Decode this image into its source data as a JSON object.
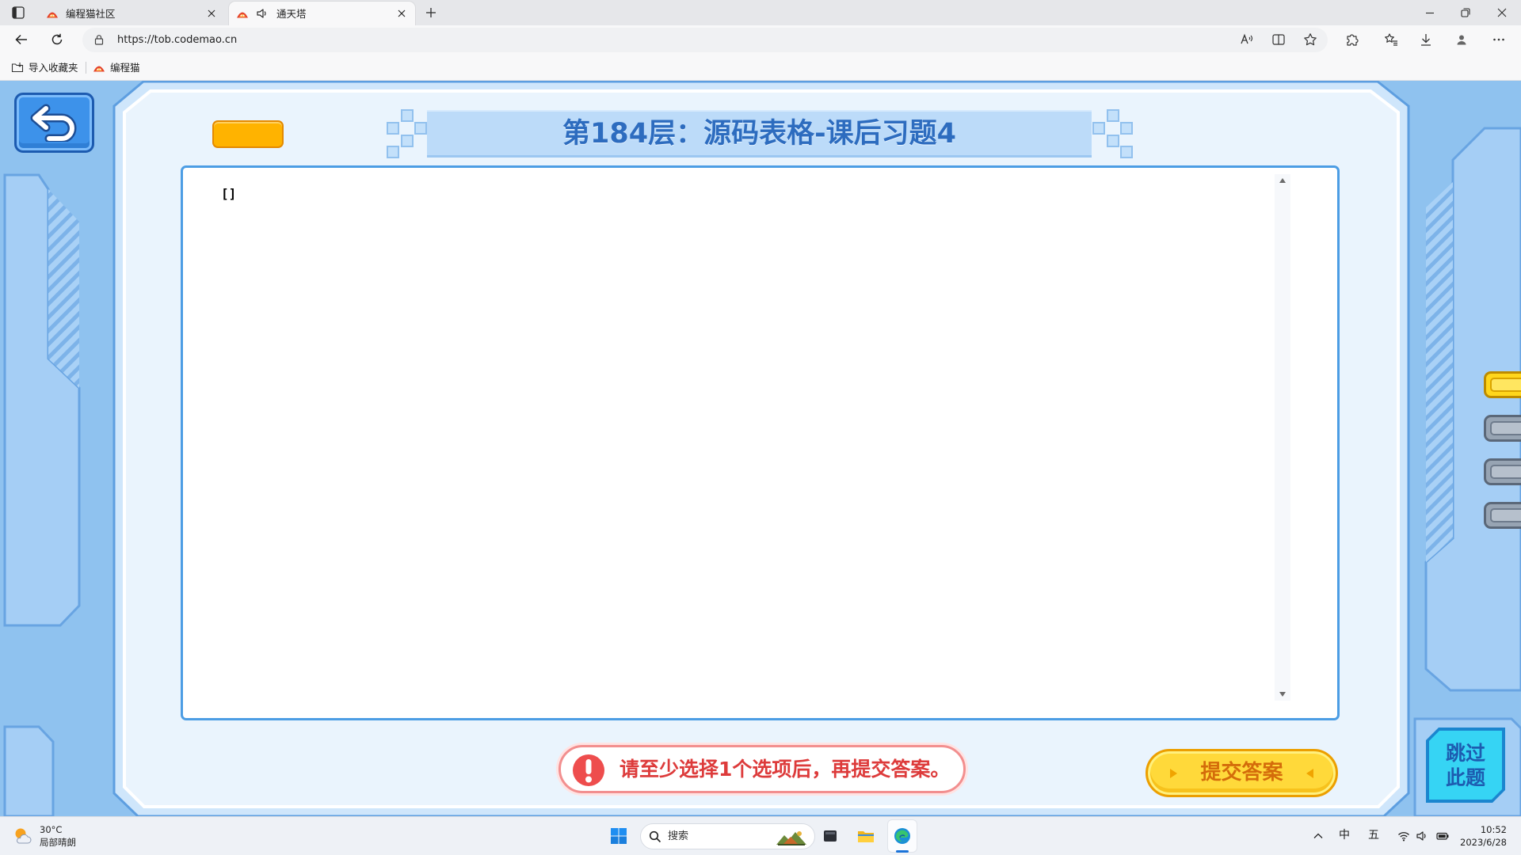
{
  "browser": {
    "tabs": [
      {
        "title": "编程猫社区",
        "favicon": "codemao-favicon-icon",
        "active": false
      },
      {
        "title": "通天塔",
        "favicon": "codemao-favicon-icon",
        "audio_icon": "speaker-icon",
        "active": true
      }
    ],
    "url": "https://tob.codemao.cn",
    "address_bar_icons": [
      "read-aloud-icon",
      "split-screen-icon",
      "favorite-star-icon"
    ],
    "toolbar_icons": [
      "extensions-icon",
      "favorites-icon",
      "download-icon",
      "profile-icon",
      "more-icon"
    ],
    "bookmarks": [
      {
        "label": "导入收藏夹",
        "icon": "import-favorites-icon"
      },
      {
        "label": "编程猫",
        "icon": "codemao-favicon-icon"
      }
    ]
  },
  "game": {
    "back_icon": "back-arrow-icon",
    "level_title": "第184层：源码表格-课后习题4",
    "content_text": "[]",
    "warning_icon": "exclamation-icon",
    "warning_text": "请至少选择1个选项后，再提交答案。",
    "submit_label": "提交答案",
    "skip_label": [
      "跳过",
      "此题"
    ],
    "side_tabs": [
      {
        "active": true
      },
      {
        "active": false
      },
      {
        "active": false
      },
      {
        "active": false
      }
    ]
  },
  "taskbar": {
    "weather": {
      "icon": "partly-sunny-icon",
      "temperature": "30°C",
      "condition": "局部晴朗"
    },
    "search_placeholder": "搜索",
    "pinned": [
      "start-windows-icon",
      "task-app-icon",
      "file-explorer-icon",
      "edge-browser-icon"
    ],
    "ime": {
      "language": "中",
      "mode": "五"
    },
    "tray_icons": [
      "chevron-up-icon",
      "wifi-icon",
      "volume-icon",
      "battery-icon"
    ],
    "clock": {
      "time": "10:52",
      "date": "2023/6/28"
    }
  },
  "colors": {
    "page_background": "#8fc2ef",
    "panel_fill": "#eaf4fd",
    "title_text": "#2d6cbf",
    "content_border": "#4c9de4",
    "warning_text": "#dd3b3b",
    "submit_fill": "#ffd93a",
    "submit_text": "#d46c0a",
    "skip_fill": "#36d4f4",
    "orange_button": "#ffb300",
    "side_tab_active": "#ffd61c",
    "side_tab_inactive": "#97a4b3"
  }
}
